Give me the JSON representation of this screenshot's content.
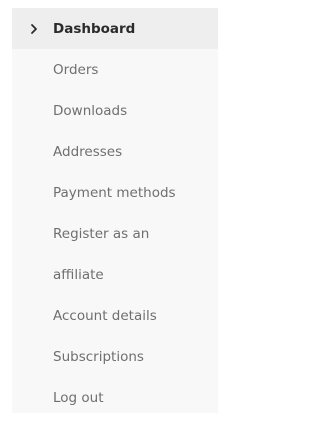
{
  "account_nav": {
    "active_indicator_icon": "chevron-right-icon",
    "items": [
      {
        "label": "Dashboard",
        "active": true
      },
      {
        "label": "Orders"
      },
      {
        "label": "Downloads"
      },
      {
        "label": "Addresses"
      },
      {
        "label": "Payment methods"
      },
      {
        "label": "Register as an"
      },
      {
        "label": "affiliate"
      },
      {
        "label": "Account details"
      },
      {
        "label": "Subscriptions"
      },
      {
        "label": "Log out"
      }
    ]
  }
}
